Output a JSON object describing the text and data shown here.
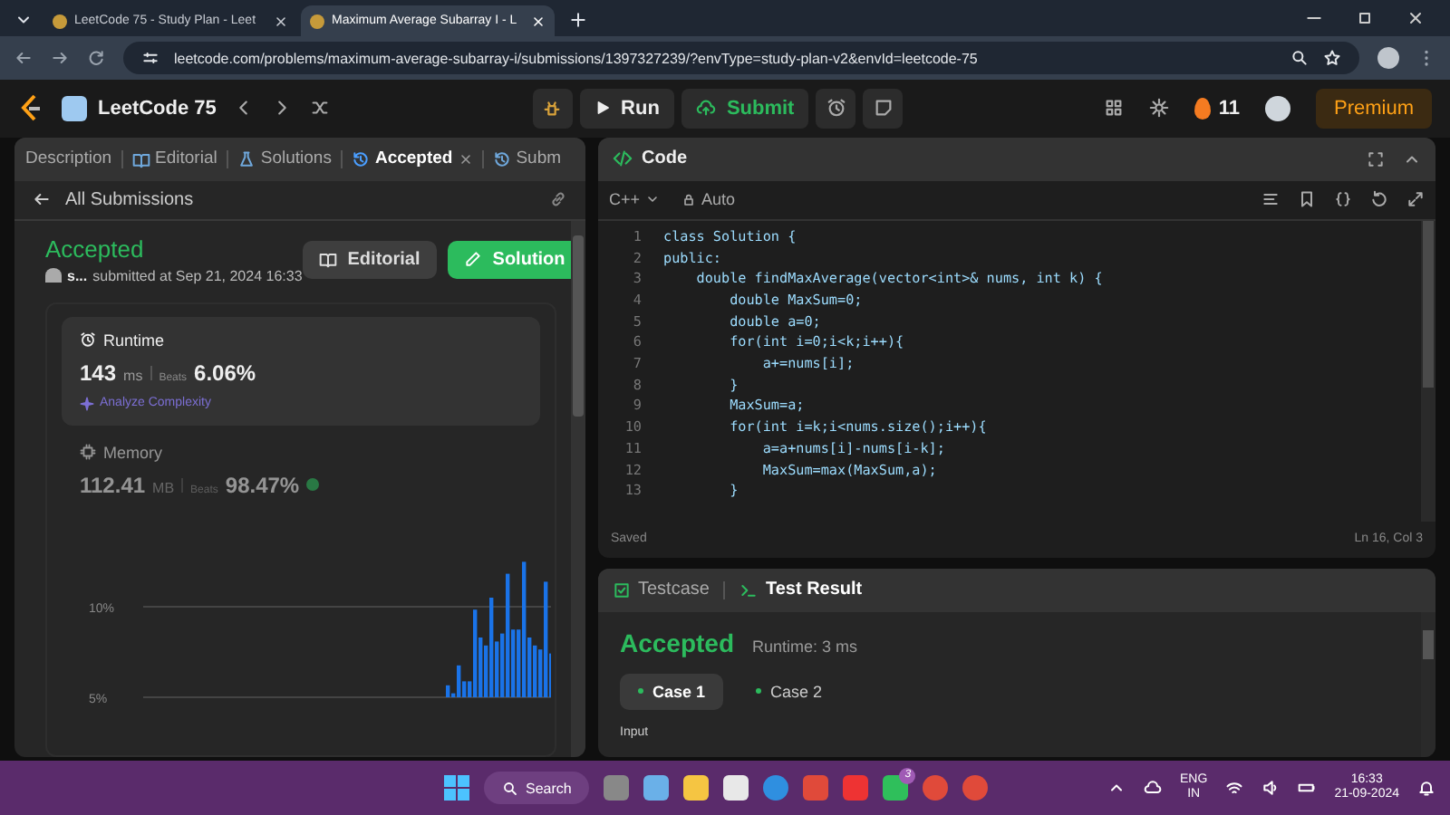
{
  "browser": {
    "tabs": [
      {
        "title": "LeetCode 75 - Study Plan - Leet",
        "selected": false
      },
      {
        "title": "Maximum Average Subarray I - L",
        "selected": true
      }
    ],
    "url": "leetcode.com/problems/maximum-average-subarray-i/submissions/1397327239/?envType=study-plan-v2&envId=leetcode-75"
  },
  "topbar": {
    "study_plan": "LeetCode 75",
    "run": "Run",
    "submit": "Submit",
    "streak": "11",
    "premium": "Premium"
  },
  "left_tabs": [
    {
      "label": "Description",
      "selected": false
    },
    {
      "label": "Editorial",
      "selected": false
    },
    {
      "label": "Solutions",
      "selected": false
    },
    {
      "label": "Accepted",
      "selected": true
    },
    {
      "label": "Subm",
      "selected": false
    }
  ],
  "back_link": "All Submissions",
  "submission": {
    "status": "Accepted",
    "user": "s...",
    "submitted": "submitted at Sep 21, 2024 16:33",
    "editorial_button": "Editorial",
    "solution_button": "Solution"
  },
  "runtime": {
    "title": "Runtime",
    "value": "143",
    "unit": "ms",
    "beats_label": "Beats",
    "beats": "6.06%",
    "analyze": "Analyze Complexity"
  },
  "memory": {
    "title": "Memory",
    "value": "112.41",
    "unit": "MB",
    "beats_label": "Beats",
    "beats": "98.47%"
  },
  "histogram": {
    "ticks": [
      "10%",
      "5%"
    ]
  },
  "code_panel": {
    "title": "Code",
    "language": "C++",
    "mode": "Auto",
    "lines": [
      {
        "number": "1",
        "text": "class Solution {"
      },
      {
        "number": "2",
        "text": "public:"
      },
      {
        "number": "3",
        "text": "    double findMaxAverage(vector<int>& nums, int k) {"
      },
      {
        "number": "4",
        "text": "        double MaxSum=0;"
      },
      {
        "number": "5",
        "text": "        double a=0;"
      },
      {
        "number": "6",
        "text": "        for(int i=0;i<k;i++){"
      },
      {
        "number": "7",
        "text": "            a+=nums[i];"
      },
      {
        "number": "8",
        "text": "        }"
      },
      {
        "number": "9",
        "text": "        MaxSum=a;"
      },
      {
        "number": "10",
        "text": "        for(int i=k;i<nums.size();i++){"
      },
      {
        "number": "11",
        "text": "            a=a+nums[i]-nums[i-k];"
      },
      {
        "number": "12",
        "text": "            MaxSum=max(MaxSum,a);"
      },
      {
        "number": "13",
        "text": "        }"
      }
    ],
    "status": "Saved",
    "cursor": "Ln 16, Col 3"
  },
  "result_panel": {
    "tabs": [
      {
        "label": "Testcase",
        "selected": false
      },
      {
        "label": "Test Result",
        "selected": true
      }
    ],
    "status": "Accepted",
    "runtime": "Runtime: 3 ms",
    "cases": [
      {
        "label": "Case 1",
        "selected": true
      },
      {
        "label": "Case 2",
        "selected": false
      }
    ],
    "input_label": "Input"
  },
  "taskbar": {
    "search": "Search",
    "chat_badge": "3",
    "language": "ENG",
    "region": "IN",
    "time": "16:33",
    "date": "21-09-2024"
  }
}
